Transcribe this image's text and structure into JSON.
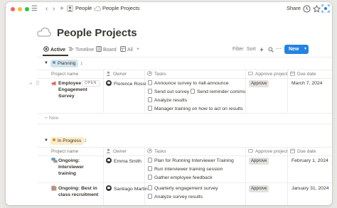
{
  "colors": {
    "accent": "#2383e2",
    "planning": "#d3e5ef",
    "in_progress": "#fdecc8"
  },
  "topbar": {
    "menu_icon": "hamburger-icon",
    "breadcrumb": [
      {
        "label": "People",
        "icon": "person-icon"
      },
      {
        "label": "People Projects",
        "icon": "cloud-icon"
      }
    ],
    "share_label": "Share"
  },
  "page": {
    "title": "People Projects",
    "icon": "cloud-icon"
  },
  "views": [
    {
      "label": "Active",
      "icon": "target-icon",
      "active": true
    },
    {
      "label": "Timeline",
      "icon": "timeline-icon",
      "active": false
    },
    {
      "label": "Board",
      "icon": "board-icon",
      "active": false
    },
    {
      "label": "All",
      "icon": "table-icon",
      "active": false
    }
  ],
  "toolbar": {
    "filter_label": "Filter",
    "sort_label": "Sort",
    "new_label": "New"
  },
  "columns": {
    "project": "Project name",
    "owner": "Owner",
    "tasks": "Tasks",
    "approve": "Approve project",
    "due": "Due date"
  },
  "groups": [
    {
      "name": "Planning",
      "count": "1",
      "rows": [
        {
          "emoji_icon": "megaphone-icon",
          "project": "Employee Engagement Survey",
          "open_label": "OPEN",
          "owner": "Florence Rossi",
          "tasks": [
            "Announce survey to #all-announce",
            "Send out survey",
            "Send reminder comms",
            "Analyze results",
            "Manager training on how to act on results"
          ],
          "approve": "Approve",
          "due": "March 7, 2024"
        }
      ],
      "new_label": "New"
    },
    {
      "name": "In Progress",
      "count": "3",
      "rows": [
        {
          "emoji_icon": "chat-bubbles-icon",
          "project": "Ongoing: Interviewer training",
          "owner": "Emma Smith",
          "tasks": [
            "Plan for Running Interviewer Training",
            "Run interviewer training session",
            "Gather employee feedback"
          ],
          "approve": "Approve",
          "due": "February 1, 2024"
        },
        {
          "emoji_icon": "books-icon",
          "project": "Ongoing: Best in class recruitment",
          "owner": "Santiago Martin",
          "tasks": [
            "Quarterly engagement survey",
            "Analyze survey results"
          ],
          "approve": "Approve",
          "due": "January 31, 2024"
        }
      ]
    }
  ]
}
